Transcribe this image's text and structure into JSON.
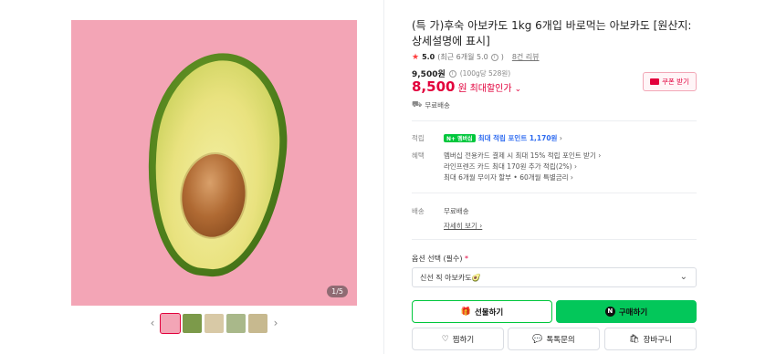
{
  "product": {
    "title": "(특 가)후숙 아보카도 1kg 6개입 바로먹는 아보카도 [원산지: 상세설명에 표시]",
    "rating": "5.0",
    "rating_note": "(최근 6개월 5.0",
    "review_link": "8건 리뷰",
    "original_price": "9,500원",
    "unit_price": "(100g당 528원)",
    "sale_price": "8,500",
    "sale_unit": "원",
    "max_discount_label": "최대할인가",
    "coupon_label": "쿠폰 받기",
    "free_shipping": "무료배송",
    "image_counter": "1/5"
  },
  "benefits": {
    "points_label": "적립",
    "npay_badge": "N+ 멤버십",
    "points_text": "최대 적립 포인트 1,170원",
    "benefit_label": "혜택",
    "lines": [
      "멤버십 전용카드 결제 시 최대 15% 적립 포인트 받기",
      "라인프렌즈 카드 최대 170원 추가 적립(2%)",
      "최대 6개월 무이자 할부 • 60개월 특별금리"
    ]
  },
  "shipping": {
    "label": "배송",
    "value": "무료배송",
    "detail_link": "자세히 보기"
  },
  "option": {
    "label": "옵션 선택 (필수)",
    "required_mark": "*",
    "selected": "신선 직 아보카도🥑"
  },
  "buttons": {
    "gift": "선물하기",
    "buy": "구매하기",
    "wish": "찜하기",
    "talk": "톡톡문의",
    "cart": "장바구니"
  },
  "colors": {
    "accent": "#e2003c",
    "npay_green": "#03c75a",
    "image_bg": "#f3a5b6"
  }
}
